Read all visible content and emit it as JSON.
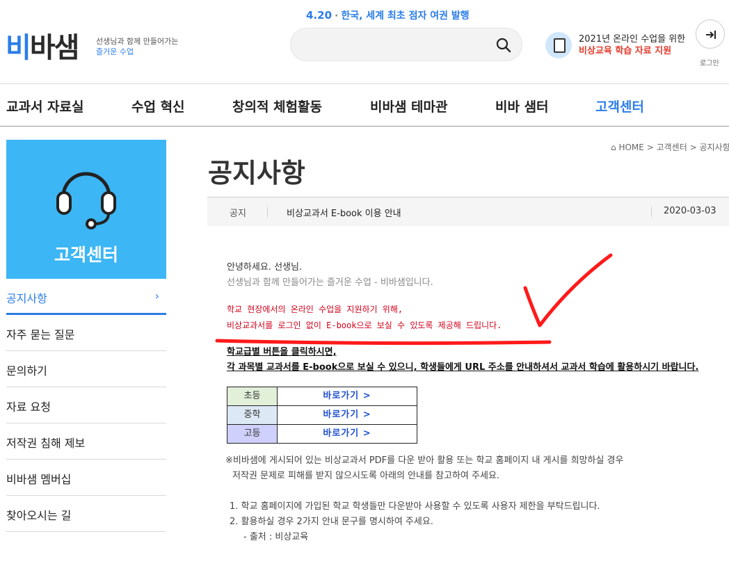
{
  "header": {
    "logo": {
      "part1": "비",
      "part2": "바샘"
    },
    "tagline": {
      "line1": "선생님과 함께 만들어가는",
      "line2": "즐거운 수업"
    },
    "headline": {
      "date": "4.20",
      "text": "한국, 세계 최초 점자 여권 발행"
    },
    "search": {
      "placeholder": ""
    },
    "promo": {
      "line1": "2021년 온라인 수업을 위한",
      "line2": "비상교육 학습 자료 지원"
    },
    "login_label": "로그인"
  },
  "nav": {
    "items": [
      "교과서 자료실",
      "수업 혁신",
      "창의적 체험활동",
      "비바샘 테마관",
      "비바 샘터",
      "고객센터"
    ]
  },
  "sidebar": {
    "title": "고객센터",
    "items": [
      "공지사항",
      "자주 묻는 질문",
      "문의하기",
      "자료 요청",
      "저작권 침해 제보",
      "비바샘 멤버십",
      "찾아오시는 길"
    ],
    "active_chevron": "›"
  },
  "breadcrumb": {
    "home": "HOME",
    "sep": ">",
    "level1": "고객센터",
    "level2": "공지사항"
  },
  "page_title": "공지사항",
  "notice": {
    "category": "공지",
    "title": "비상교과서 E-book 이용 안내",
    "date": "2020-03-03"
  },
  "content": {
    "greeting": "안녕하세요. 선생님.",
    "intro": "선생님과 함께 만들어가는 즐거운 수업 - 비바샘입니다.",
    "red_line1": "학교 현장에서의 온라인 수업을 지원하기 위해,",
    "red_line2": "비상교과서를 로그인 없이 E-book으로 보실 수 있도록 제공해 드립니다.",
    "bold_line1": "학교급별 버튼을 클릭하시면,",
    "bold_line2": "각 과목별 교과서를 E-book으로 보실 수 있으니, 학생들에게 URL 주소를 안내하셔서 교과서 학습에 활용하시기 바랍니다.",
    "table": [
      {
        "level": "초등",
        "link": "바로가기 >"
      },
      {
        "level": "중학",
        "link": "바로가기 >"
      },
      {
        "level": "고등",
        "link": "바로가기 >"
      }
    ],
    "note_line1": "※비바샘에 게시되어 있는 비상교과서 PDF를 다운 받아 활용 또는 학교 홈페이지 내 게시를 희망하실 경우",
    "note_line2": "저작권 문제로 피해를 받지 않으시도록 아래의 안내를 참고하여 주세요.",
    "list1": "1. 학교 홈페이지에 가입된 학교 학생들만 다운받아 사용할 수 있도록 사용자 제한을 부탁드립니다.",
    "list2": "2. 활용하실 경우 2가지 안내 문구를 명시하여 주세요.",
    "list2_sub": "- 출처 : 비상교육"
  },
  "colors": {
    "accent": "#2b7de9",
    "sidebar_bg": "#3cb6f4",
    "alert_red": "#d0021b",
    "annotation_red": "#ff0000"
  }
}
